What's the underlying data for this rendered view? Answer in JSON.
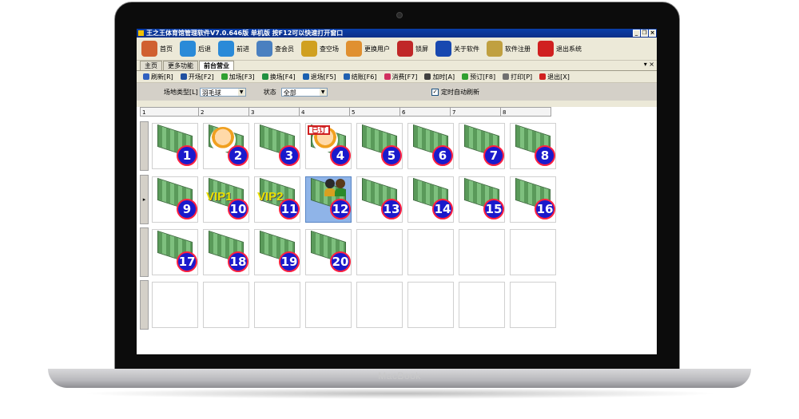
{
  "device": {
    "brand": "MacBook"
  },
  "window": {
    "title": "王之王体育馆管理软件V7.0.646版 单机版 按F12可以快速打开窗口",
    "controls": [
      "_",
      "❐",
      "×"
    ]
  },
  "toolbar": [
    {
      "label": "首页",
      "icon": "home-icon",
      "color": "#d06030"
    },
    {
      "label": "后退",
      "icon": "back-arrow-icon",
      "color": "#2a8ad8"
    },
    {
      "label": "前进",
      "icon": "forward-arrow-icon",
      "color": "#2a8ad8"
    },
    {
      "label": "查会员",
      "icon": "member-icon",
      "color": "#4a80c0"
    },
    {
      "label": "查空场",
      "icon": "magnifier-icon",
      "color": "#d0a020"
    },
    {
      "label": "更换用户",
      "icon": "switch-user-icon",
      "color": "#e09030"
    },
    {
      "label": "锁屏",
      "icon": "lock-icon",
      "color": "#c02828"
    },
    {
      "label": "关于软件",
      "icon": "info-icon",
      "color": "#1848b0"
    },
    {
      "label": "软件注册",
      "icon": "keys-icon",
      "color": "#c0a040"
    },
    {
      "label": "退出系统",
      "icon": "power-icon",
      "color": "#d02020"
    }
  ],
  "tabs": [
    {
      "label": "主页",
      "active": false
    },
    {
      "label": "更多功能",
      "active": false
    },
    {
      "label": "前台营业",
      "active": true
    }
  ],
  "tab_controls": "▾ ×",
  "actions": [
    {
      "label": "刷新[R]",
      "icon": "refresh-icon",
      "color": "#3060c0"
    },
    {
      "label": "开场[F2]",
      "icon": "open-court-icon",
      "color": "#2050a0"
    },
    {
      "label": "加场[F3]",
      "icon": "add-court-icon",
      "color": "#30a030"
    },
    {
      "label": "换场[F4]",
      "icon": "change-court-icon",
      "color": "#209040"
    },
    {
      "label": "退场[F5]",
      "icon": "exit-court-icon",
      "color": "#1a60b0"
    },
    {
      "label": "结账[F6]",
      "icon": "checkout-icon",
      "color": "#2060b0"
    },
    {
      "label": "消费[F7]",
      "icon": "cart-icon",
      "color": "#d03060"
    },
    {
      "label": "加时[A]",
      "icon": "clock-icon",
      "color": "#404040"
    },
    {
      "label": "预订[F8]",
      "icon": "reserve-icon",
      "color": "#30a030"
    },
    {
      "label": "打印[P]",
      "icon": "printer-icon",
      "color": "#707070"
    },
    {
      "label": "退出[X]",
      "icon": "exit-icon",
      "color": "#d02020"
    }
  ],
  "filter": {
    "venue_type_label": "场地类型[L]",
    "venue_type_value": "羽毛球",
    "status_label": "状态",
    "status_value": "全部",
    "auto_refresh_label": "定时自动刷新",
    "auto_refresh_checked": true
  },
  "grid": {
    "column_headers": [
      "1",
      "2",
      "3",
      "4",
      "5",
      "6",
      "7",
      "8"
    ],
    "row_indicator": "▸",
    "rows": [
      [
        {
          "num": "1",
          "kind": "court"
        },
        {
          "num": "2",
          "kind": "person"
        },
        {
          "num": "3",
          "kind": "court"
        },
        {
          "num": "4",
          "kind": "person-stamp",
          "stamp": "已订"
        },
        {
          "num": "5",
          "kind": "court"
        },
        {
          "num": "6",
          "kind": "court"
        },
        {
          "num": "7",
          "kind": "court"
        },
        {
          "num": "8",
          "kind": "court"
        }
      ],
      [
        {
          "num": "9",
          "kind": "court"
        },
        {
          "num": "10",
          "kind": "vip",
          "vip": "VIP1"
        },
        {
          "num": "11",
          "kind": "vip",
          "vip": "VIP2"
        },
        {
          "num": "12",
          "kind": "occupied",
          "selected": true
        },
        {
          "num": "13",
          "kind": "court"
        },
        {
          "num": "14",
          "kind": "court"
        },
        {
          "num": "15",
          "kind": "court"
        },
        {
          "num": "16",
          "kind": "court"
        }
      ],
      [
        {
          "num": "17",
          "kind": "court"
        },
        {
          "num": "18",
          "kind": "court"
        },
        {
          "num": "19",
          "kind": "court"
        },
        {
          "num": "20",
          "kind": "court"
        },
        {
          "num": "",
          "kind": "empty"
        },
        {
          "num": "",
          "kind": "empty"
        },
        {
          "num": "",
          "kind": "empty"
        },
        {
          "num": "",
          "kind": "empty"
        }
      ],
      [
        {
          "num": "",
          "kind": "empty"
        },
        {
          "num": "",
          "kind": "empty"
        },
        {
          "num": "",
          "kind": "empty"
        },
        {
          "num": "",
          "kind": "empty"
        },
        {
          "num": "",
          "kind": "empty"
        },
        {
          "num": "",
          "kind": "empty"
        },
        {
          "num": "",
          "kind": "empty"
        },
        {
          "num": "",
          "kind": "empty"
        }
      ]
    ]
  }
}
